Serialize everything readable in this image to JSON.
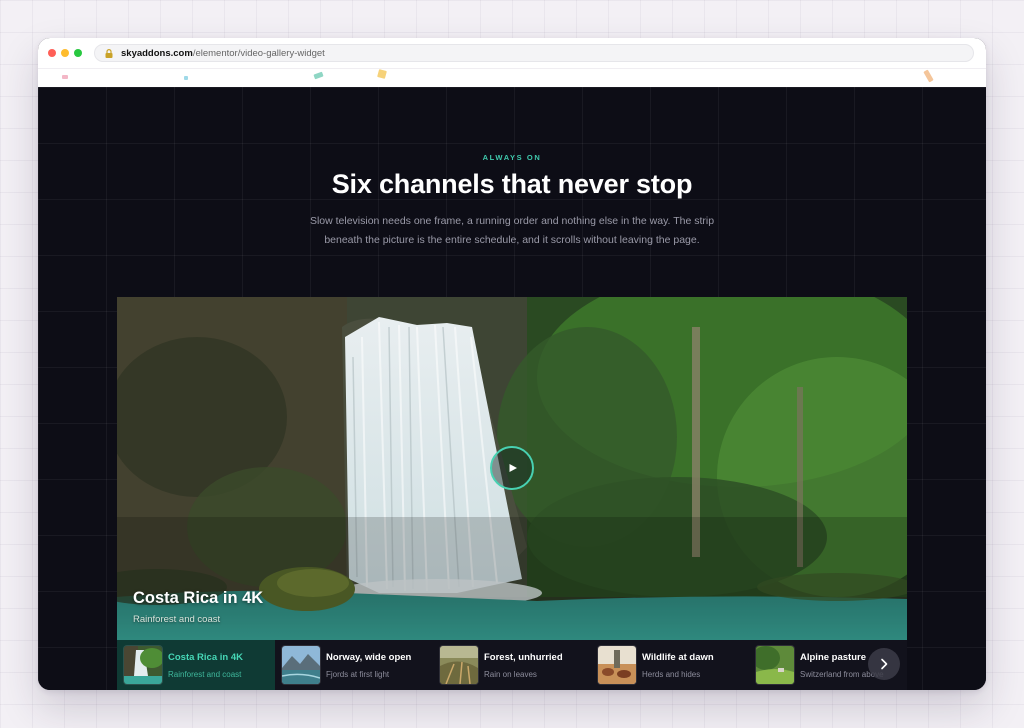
{
  "browser": {
    "url_domain": "skyaddons.com",
    "url_path": "/elementor/video-gallery-widget"
  },
  "hero": {
    "eyebrow": "ALWAYS ON",
    "title": "Six channels that never stop",
    "description": "Slow television needs one frame, a running order and nothing else in the way. The strip beneath the picture is the entire schedule, and it scrolls without leaving the page."
  },
  "player": {
    "title": "Costa Rica in 4K",
    "subtitle": "Rainforest and coast"
  },
  "playlist": [
    {
      "title": "Costa Rica in 4K",
      "subtitle": "Rainforest and coast",
      "active": true
    },
    {
      "title": "Norway, wide open",
      "subtitle": "Fjords at first light",
      "active": false
    },
    {
      "title": "Forest, unhurried",
      "subtitle": "Rain on leaves",
      "active": false
    },
    {
      "title": "Wildlife at dawn",
      "subtitle": "Herds and hides",
      "active": false
    },
    {
      "title": "Alpine pasture",
      "subtitle": "Switzerland from above",
      "active": false
    }
  ],
  "icons": {
    "lock": "lock-icon",
    "play": "play-icon",
    "next": "chevron-right-icon"
  },
  "colors": {
    "accent": "#46d7b6",
    "page_bg": "#0d0d16",
    "active_item_bg": "#0f3a34"
  }
}
